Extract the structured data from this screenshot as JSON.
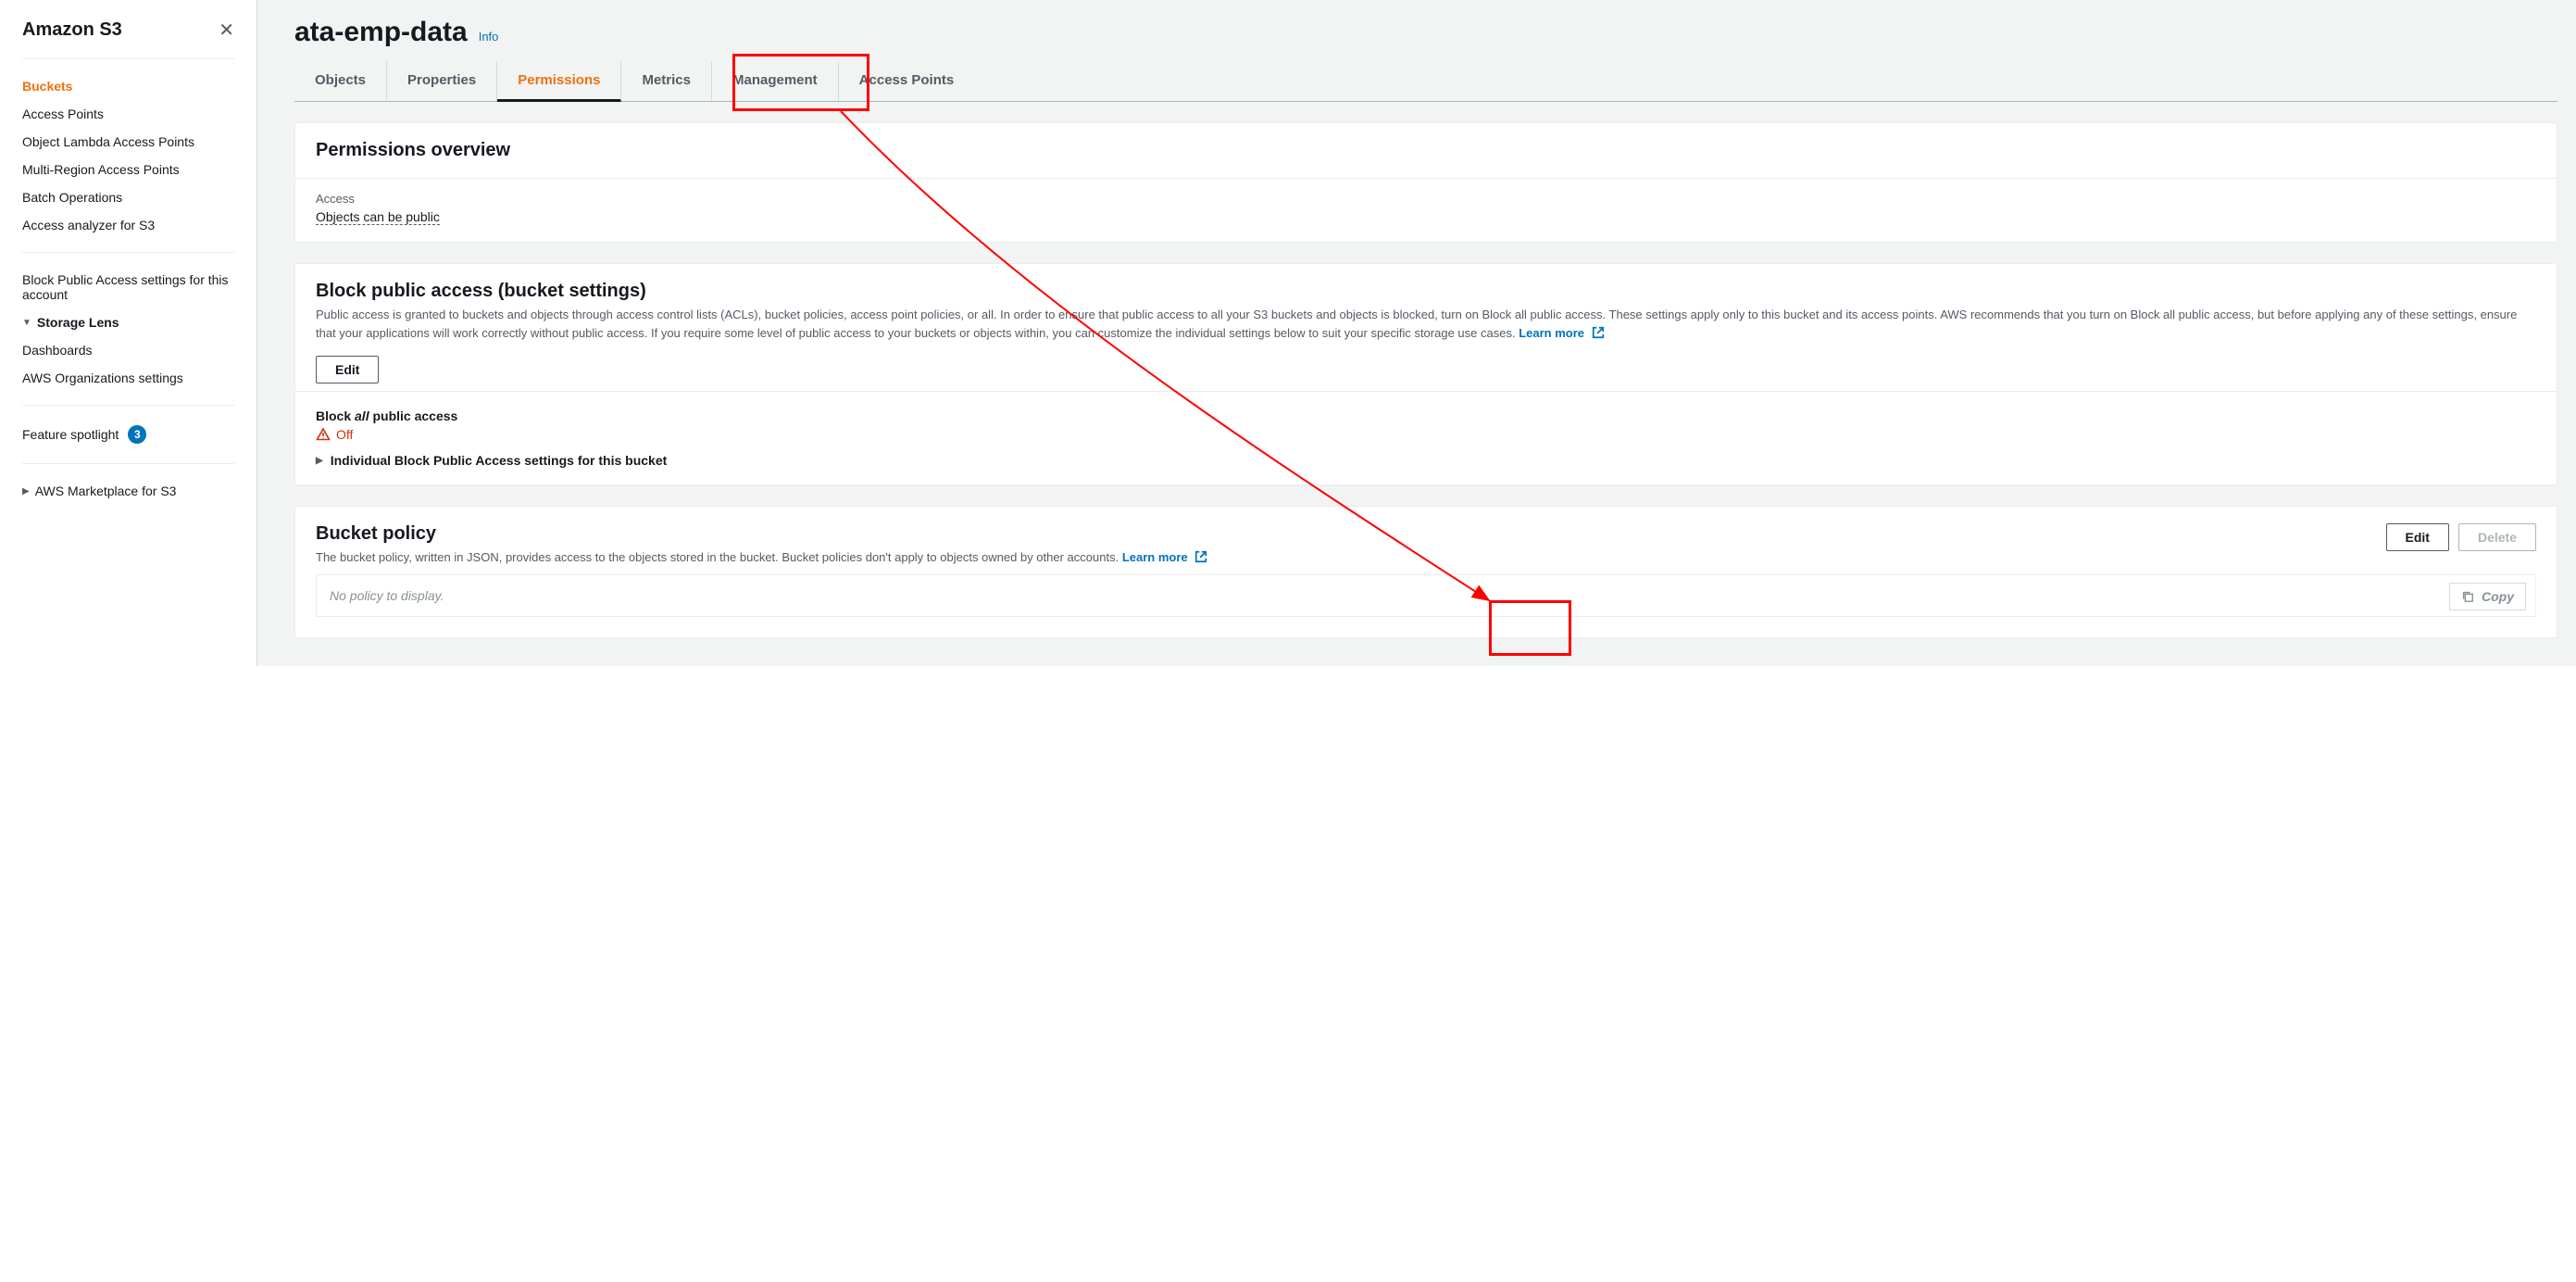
{
  "sidebar": {
    "title": "Amazon S3",
    "items": [
      {
        "label": "Buckets",
        "active": true
      },
      {
        "label": "Access Points"
      },
      {
        "label": "Object Lambda Access Points"
      },
      {
        "label": "Multi-Region Access Points"
      },
      {
        "label": "Batch Operations"
      },
      {
        "label": "Access analyzer for S3"
      }
    ],
    "block_public_access": "Block Public Access settings for this account",
    "storage_lens_header": "Storage Lens",
    "storage_lens_items": [
      {
        "label": "Dashboards"
      },
      {
        "label": "AWS Organizations settings"
      }
    ],
    "feature_spotlight_label": "Feature spotlight",
    "feature_spotlight_count": "3",
    "marketplace_label": "AWS Marketplace for S3"
  },
  "page": {
    "title": "ata-emp-data",
    "info_label": "Info"
  },
  "tabs": [
    {
      "label": "Objects"
    },
    {
      "label": "Properties"
    },
    {
      "label": "Permissions",
      "active": true
    },
    {
      "label": "Metrics"
    },
    {
      "label": "Management"
    },
    {
      "label": "Access Points"
    }
  ],
  "perm_overview": {
    "title": "Permissions overview",
    "access_label": "Access",
    "access_value": "Objects can be public"
  },
  "block_public": {
    "title": "Block public access (bucket settings)",
    "description": "Public access is granted to buckets and objects through access control lists (ACLs), bucket policies, access point policies, or all. In order to ensure that public access to all your S3 buckets and objects is blocked, turn on Block all public access. These settings apply only to this bucket and its access points. AWS recommends that you turn on Block all public access, but before applying any of these settings, ensure that your applications will work correctly without public access. If you require some level of public access to your buckets or objects within, you can customize the individual settings below to suit your specific storage use cases.",
    "learn_more": "Learn more",
    "edit_label": "Edit",
    "block_all_prefix": "Block ",
    "block_all_italic": "all",
    "block_all_suffix": " public access",
    "status": "Off",
    "individual_label": "Individual Block Public Access settings for this bucket"
  },
  "bucket_policy": {
    "title": "Bucket policy",
    "description": "The bucket policy, written in JSON, provides access to the objects stored in the bucket. Bucket policies don't apply to objects owned by other accounts.",
    "learn_more": "Learn more",
    "edit_label": "Edit",
    "delete_label": "Delete",
    "placeholder": "No policy to display.",
    "copy_label": "Copy"
  }
}
